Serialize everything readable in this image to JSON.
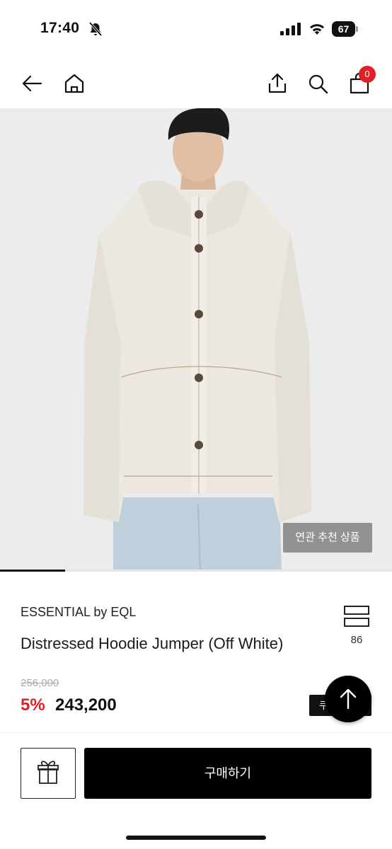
{
  "status_bar": {
    "time": "17:40",
    "battery": "67"
  },
  "nav": {
    "cart_count": "0",
    "icons": [
      "back-arrow-icon",
      "home-icon",
      "share-icon",
      "search-icon",
      "cart-icon"
    ]
  },
  "hero": {
    "related_label": "연관 추천 상품",
    "slider_progress": 0.17
  },
  "product": {
    "brand": "ESSENTIAL by EQL",
    "title": "Distressed Hoodie Jumper (Off White)",
    "compare_count": "86",
    "original_price": "256,000",
    "discount": "5%",
    "price": "243,200",
    "coupon_label": "쿠"
  },
  "footer": {
    "buy_label": "구매하기"
  },
  "colors": {
    "accent_red": "#e21f26",
    "button_black": "#000000"
  }
}
